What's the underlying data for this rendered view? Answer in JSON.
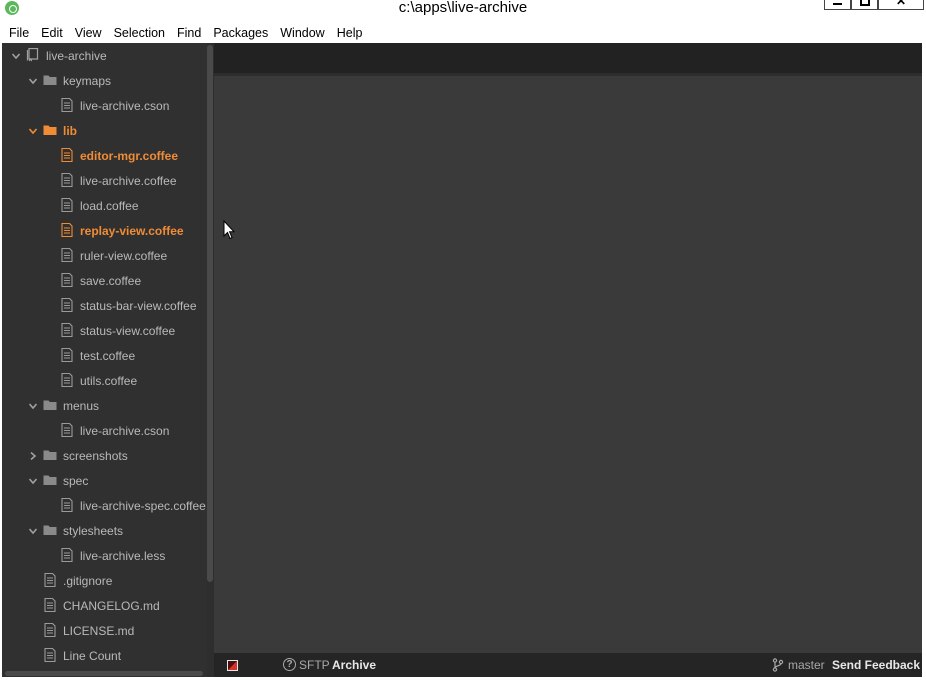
{
  "window": {
    "title": "c:\\apps\\live-archive"
  },
  "menu": [
    "File",
    "Edit",
    "View",
    "Selection",
    "Find",
    "Packages",
    "Window",
    "Help"
  ],
  "tree": [
    {
      "label": "live-archive",
      "kind": "repo",
      "depth": 0,
      "expanded": true,
      "modified": false
    },
    {
      "label": "keymaps",
      "kind": "folder",
      "depth": 1,
      "expanded": true,
      "modified": false
    },
    {
      "label": "live-archive.cson",
      "kind": "file",
      "depth": 2,
      "modified": false
    },
    {
      "label": "lib",
      "kind": "folder",
      "depth": 1,
      "expanded": true,
      "modified": true
    },
    {
      "label": "editor-mgr.coffee",
      "kind": "file",
      "depth": 2,
      "modified": true
    },
    {
      "label": "live-archive.coffee",
      "kind": "file",
      "depth": 2,
      "modified": false
    },
    {
      "label": "load.coffee",
      "kind": "file",
      "depth": 2,
      "modified": false
    },
    {
      "label": "replay-view.coffee",
      "kind": "file",
      "depth": 2,
      "modified": true
    },
    {
      "label": "ruler-view.coffee",
      "kind": "file",
      "depth": 2,
      "modified": false
    },
    {
      "label": "save.coffee",
      "kind": "file",
      "depth": 2,
      "modified": false
    },
    {
      "label": "status-bar-view.coffee",
      "kind": "file",
      "depth": 2,
      "modified": false
    },
    {
      "label": "status-view.coffee",
      "kind": "file",
      "depth": 2,
      "modified": false
    },
    {
      "label": "test.coffee",
      "kind": "file",
      "depth": 2,
      "modified": false
    },
    {
      "label": "utils.coffee",
      "kind": "file",
      "depth": 2,
      "modified": false
    },
    {
      "label": "menus",
      "kind": "folder",
      "depth": 1,
      "expanded": true,
      "modified": false
    },
    {
      "label": "live-archive.cson",
      "kind": "file",
      "depth": 2,
      "modified": false
    },
    {
      "label": "screenshots",
      "kind": "folder",
      "depth": 1,
      "expanded": false,
      "modified": false
    },
    {
      "label": "spec",
      "kind": "folder",
      "depth": 1,
      "expanded": true,
      "modified": false
    },
    {
      "label": "live-archive-spec.coffee",
      "kind": "file",
      "depth": 2,
      "modified": false
    },
    {
      "label": "stylesheets",
      "kind": "folder",
      "depth": 1,
      "expanded": true,
      "modified": false
    },
    {
      "label": "live-archive.less",
      "kind": "file",
      "depth": 2,
      "modified": false
    },
    {
      "label": ".gitignore",
      "kind": "file",
      "depth": 1,
      "modified": false
    },
    {
      "label": "CHANGELOG.md",
      "kind": "file",
      "depth": 1,
      "modified": false
    },
    {
      "label": "LICENSE.md",
      "kind": "file",
      "depth": 1,
      "modified": false
    },
    {
      "label": "Line Count",
      "kind": "file",
      "depth": 1,
      "modified": false
    }
  ],
  "statusbar": {
    "help_icon": "?",
    "sftp": "SFTP",
    "archive": "Archive",
    "branch": "master",
    "feedback": "Send Feedback"
  },
  "colors": {
    "modified": "#f08c36",
    "sidebar_bg": "#303030",
    "editor_bg": "#3a3a3a",
    "tabbar_bg": "#222222",
    "statusbar_bg": "#252525"
  }
}
